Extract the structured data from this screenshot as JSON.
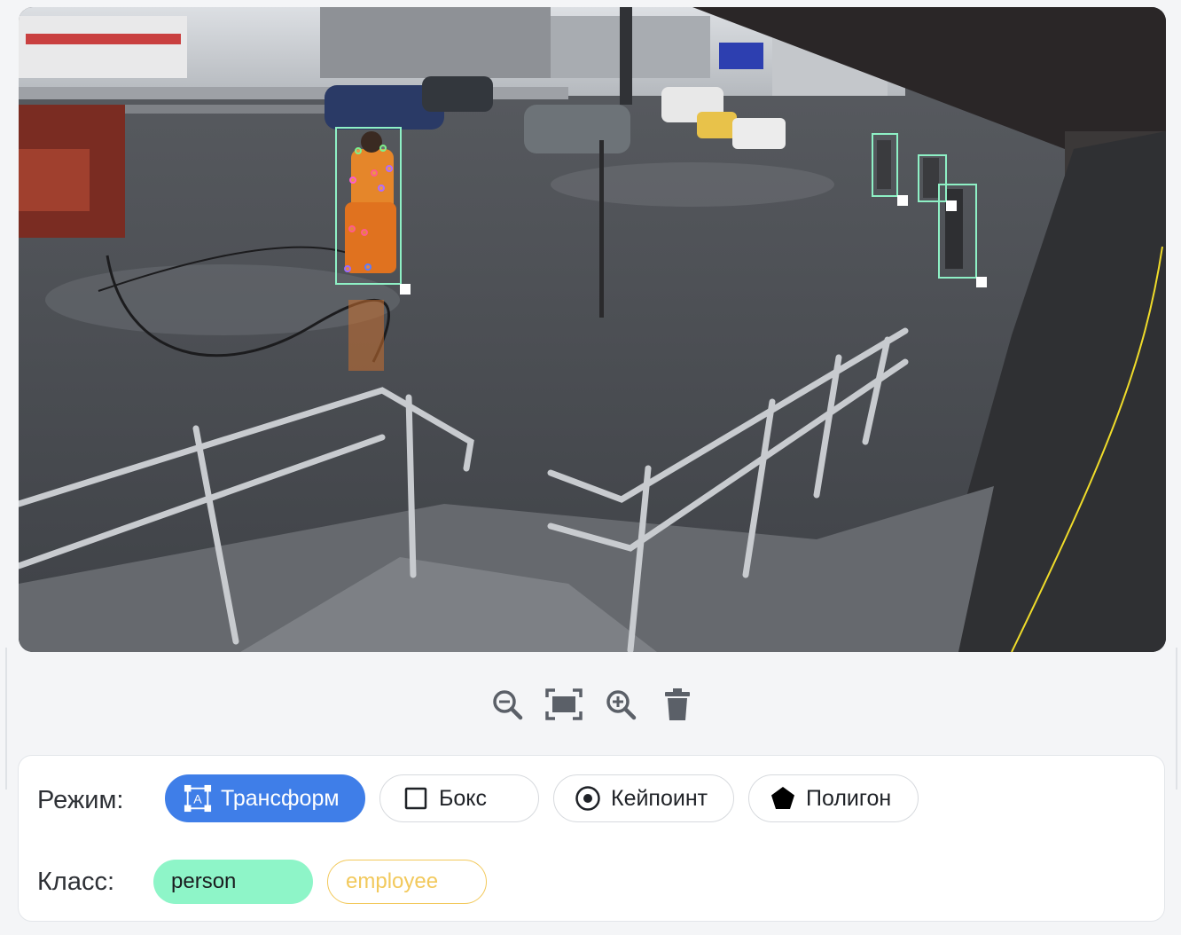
{
  "image": {
    "scene": "cctv-street-crosswalk",
    "bbox_color": "#8ef0c5",
    "keypoint_colors": [
      "#7ff28b",
      "#b06bff",
      "#ff5b8a",
      "#5b7bff"
    ]
  },
  "toolbar": {
    "zoom_out_icon": "zoom-out-icon",
    "fit_icon": "fit-screen-icon",
    "zoom_in_icon": "zoom-in-icon",
    "delete_icon": "trash-icon"
  },
  "panel": {
    "mode_label": "Режим:",
    "modes": [
      {
        "label": "Трансформ",
        "icon": "transform-icon",
        "active": true
      },
      {
        "label": "Бокс",
        "icon": "square-icon",
        "active": false
      },
      {
        "label": "Кейпоинт",
        "icon": "target-icon",
        "active": false
      },
      {
        "label": "Полигон",
        "icon": "pentagon-icon",
        "active": false
      }
    ],
    "class_label": "Класс:",
    "classes": [
      {
        "label": "person",
        "color": "#8ef5c8",
        "selected": true
      },
      {
        "label": "employee",
        "color": "#f2c95c",
        "selected": false
      }
    ],
    "accent": "#3f7ee8"
  }
}
